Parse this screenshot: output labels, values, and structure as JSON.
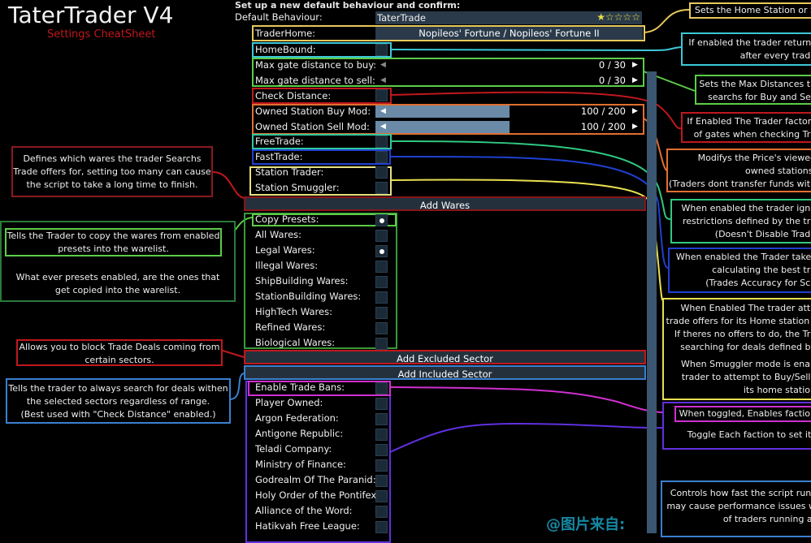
{
  "header": {
    "title": "TaterTrader V4",
    "subtitle": "Settings CheatSheet",
    "setup_text": "Set up a new default behaviour and confirm:"
  },
  "settings": {
    "default_behaviour": {
      "label": "Default Behaviour:",
      "value": "TaterTrade",
      "rating": 1,
      "rating_max": 5,
      "stars": "★☆☆☆☆"
    },
    "trader_home": {
      "label": "TraderHome:",
      "value": "Nopileos' Fortune / Nopileos' Fortune II"
    },
    "home_bound": {
      "label": "HomeBound:",
      "checked": false
    },
    "max_buy": {
      "label": "Max gate distance to buy:",
      "value": "0 / 30"
    },
    "max_sell": {
      "label": "Max gate distance to sell:",
      "value": "0 / 30"
    },
    "check_distance": {
      "label": "Check Distance:",
      "checked": false
    },
    "buy_mod": {
      "label": "Owned Station Buy Mod:",
      "value": "100 / 200",
      "fraction": 0.5
    },
    "sell_mod": {
      "label": "Owned Station Sell Mod:",
      "value": "100 / 200",
      "fraction": 0.5
    },
    "free_trade": {
      "label": "FreeTrade:",
      "checked": false
    },
    "fast_trade": {
      "label": "FastTrade:",
      "checked": false
    },
    "station_trader": {
      "label": "Station Trader:",
      "checked": false
    },
    "station_smuggler": {
      "label": "Station Smuggler:",
      "checked": false
    }
  },
  "buttons": {
    "add_wares": "Add Wares",
    "add_excluded": "Add Excluded Sector",
    "add_included": "Add Included Sector"
  },
  "wares": [
    {
      "label": "Copy Presets:",
      "checked": true
    },
    {
      "label": "All Wares:",
      "checked": false
    },
    {
      "label": "Legal Wares:",
      "checked": true
    },
    {
      "label": "Illegal Wares:",
      "checked": false
    },
    {
      "label": "ShipBuilding Wares:",
      "checked": false
    },
    {
      "label": "StationBuilding Wares:",
      "checked": false
    },
    {
      "label": "HighTech Wares:",
      "checked": false
    },
    {
      "label": "Refined Wares:",
      "checked": false
    },
    {
      "label": "Biological Wares:",
      "checked": false
    }
  ],
  "factions": [
    {
      "label": "Enable Trade Bans:",
      "checked": false
    },
    {
      "label": "Player Owned:",
      "checked": false
    },
    {
      "label": "Argon Federation:",
      "checked": false
    },
    {
      "label": "Antigone Republic:",
      "checked": false
    },
    {
      "label": "Teladi Company:",
      "checked": false
    },
    {
      "label": "Ministry of Finance:",
      "checked": false
    },
    {
      "label": "Godrealm Of The Paranid:",
      "checked": false
    },
    {
      "label": "Holy Order of the Pontifex:",
      "checked": false
    },
    {
      "label": "Alliance of the Word:",
      "checked": false
    },
    {
      "label": "Hatikvah Free League:",
      "checked": false
    }
  ],
  "notes_left": {
    "wares": [
      "Defines which wares the trader Searchs",
      "Trade offers for, setting too many can cause",
      "the script to take a long time to finish."
    ],
    "copy": [
      "Tells the Trader to copy the wares from enabled",
      "presets into the warelist."
    ],
    "copy_extra": [
      "What ever presets enabled, are the ones that",
      "get copied into the warelist."
    ],
    "excluded": [
      "Allows you to block Trade Deals coming from",
      "certain sectors."
    ],
    "included": [
      "Tells the trader to always search for deals withen",
      "the selected sectors regardless of range.",
      "(Best used with \"Check Distance\" enabled.)"
    ]
  },
  "notes_right": {
    "home": [
      "Sets the Home Station or S"
    ],
    "homebound": [
      "If enabled the trader returns",
      "after every trade"
    ],
    "maxdist": [
      "Sets the Max Distances th",
      "searchs for Buy and Sell"
    ],
    "checkdist": [
      "If Enabled The Trader factors",
      "of gates when checking Tra"
    ],
    "mods": [
      "Modifys the Price's viewed",
      "owned stations.",
      "(Traders dont transfer funds with"
    ],
    "free": [
      "When enabled the trader igno",
      "restrictions defined by the tra",
      "(Doesn't Disable Trade"
    ],
    "fast": [
      "When enabled the Trader takes",
      "calculating the best tra",
      "(Trades Accuracy for Sca"
    ],
    "station": [
      "When Enabled The trader atte",
      "trade offers for its Home station (",
      "If theres no offers to do, the Tra",
      "searching for deals defined by"
    ],
    "smuggler": [
      "When Smuggler mode is enab",
      "trader to attempt to Buy/Sell i",
      "its home station"
    ],
    "bans": [
      "When toggled, Enables faction"
    ],
    "faction": [
      "Toggle Each faction to set its"
    ],
    "speed": [
      "Controls how fast the script runs",
      "may cause performance issues w",
      "of traders running at"
    ]
  },
  "watermark": "@图片来自:",
  "colors": {
    "yellow": "#e8c85a",
    "cyan": "#3cc8d8",
    "green": "#5ccc48",
    "red": "#c0181c",
    "orange": "#e07030",
    "teal": "#30c880",
    "blue": "#2040d0",
    "lightblue": "#3a80d0",
    "magenta": "#d030d0",
    "purple": "#6030e0",
    "panel": "#2a3a4a",
    "slider": "#6a8aa8"
  }
}
